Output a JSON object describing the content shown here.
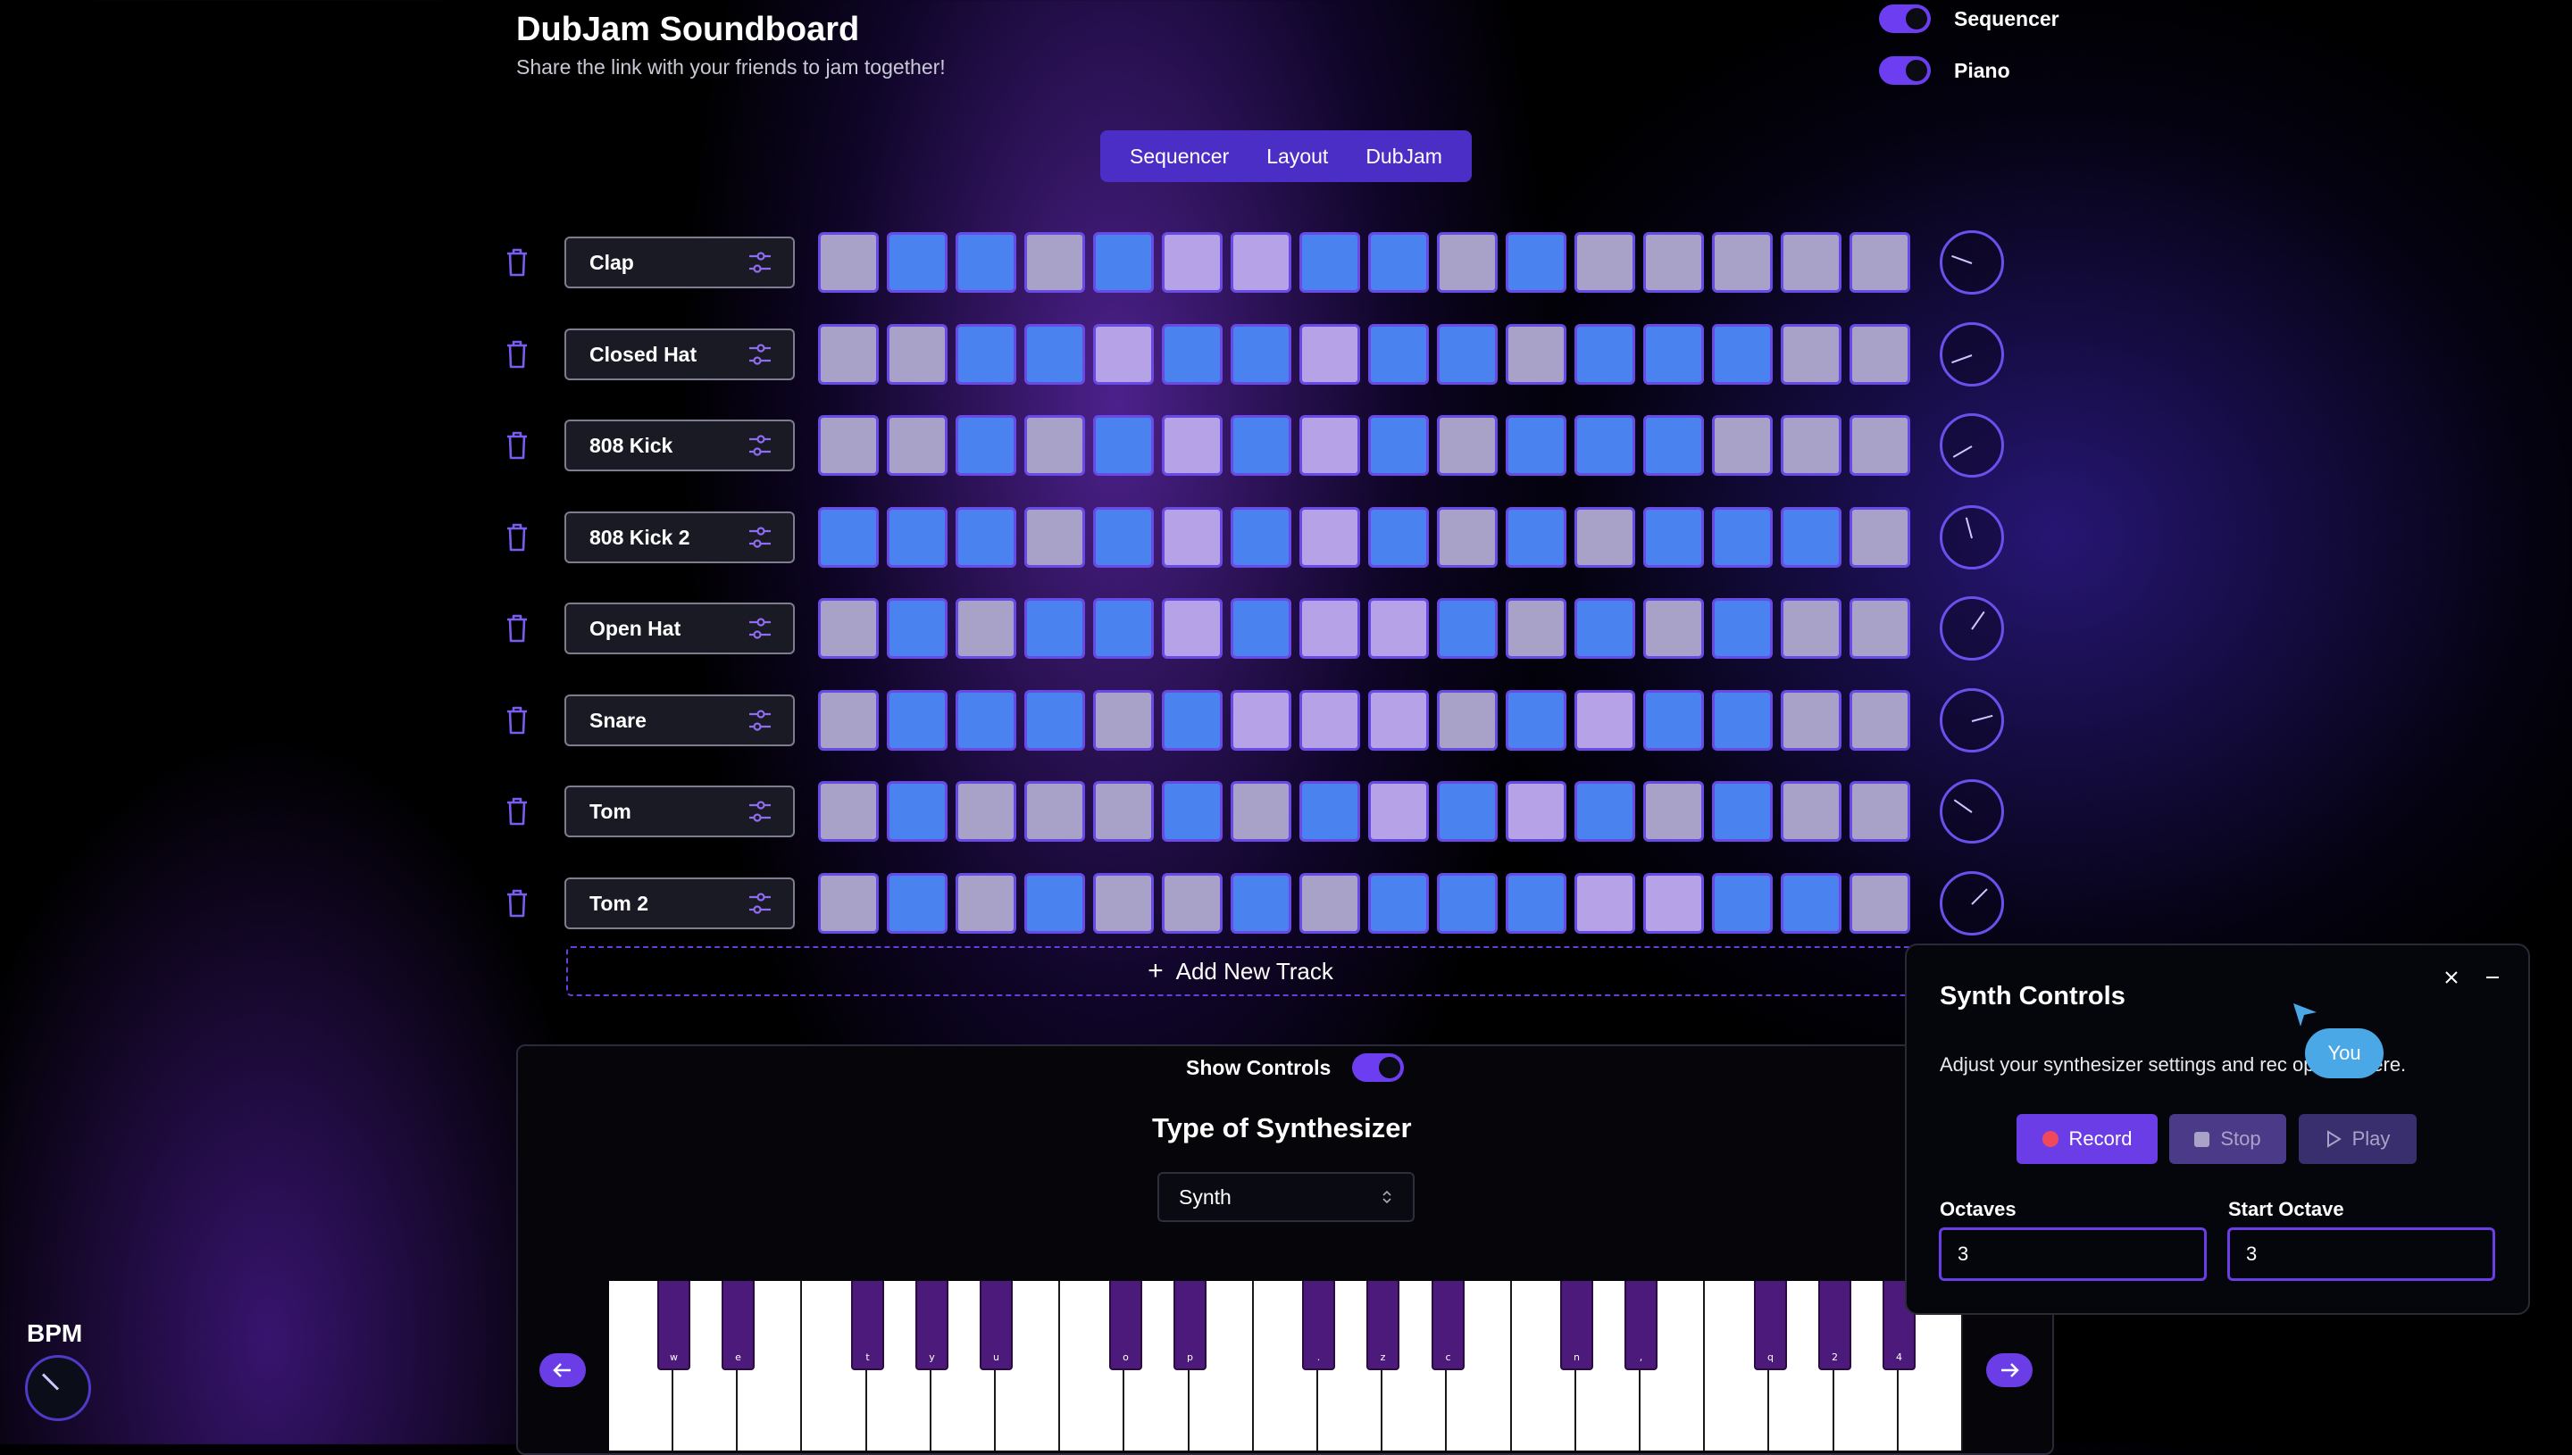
{
  "header": {
    "title": "DubJam Soundboard",
    "subtitle": "Share the link with your friends to jam together!"
  },
  "toggles": [
    {
      "label": "Sequencer",
      "on": true
    },
    {
      "label": "Piano",
      "on": true
    }
  ],
  "tabs": [
    "Sequencer",
    "Layout",
    "DubJam"
  ],
  "tracks": [
    {
      "name": "Clap",
      "steps": [
        0,
        1,
        1,
        0,
        1,
        2,
        2,
        1,
        1,
        0,
        1,
        0,
        0,
        0,
        0,
        0
      ],
      "knob_angle": 200
    },
    {
      "name": "Closed Hat",
      "steps": [
        0,
        0,
        1,
        1,
        2,
        1,
        1,
        2,
        1,
        1,
        0,
        1,
        1,
        1,
        0,
        0
      ],
      "knob_angle": 160
    },
    {
      "name": "808 Kick",
      "steps": [
        0,
        0,
        1,
        0,
        1,
        2,
        1,
        2,
        1,
        0,
        1,
        1,
        1,
        0,
        0,
        0
      ],
      "knob_angle": 150
    },
    {
      "name": "808 Kick 2",
      "steps": [
        1,
        1,
        1,
        0,
        1,
        2,
        1,
        2,
        1,
        0,
        1,
        0,
        1,
        1,
        1,
        0
      ],
      "knob_angle": 255
    },
    {
      "name": "Open Hat",
      "steps": [
        0,
        1,
        0,
        1,
        1,
        2,
        1,
        2,
        2,
        1,
        0,
        1,
        0,
        1,
        0,
        0
      ],
      "knob_angle": 305
    },
    {
      "name": "Snare",
      "steps": [
        0,
        1,
        1,
        1,
        0,
        1,
        2,
        2,
        2,
        0,
        1,
        2,
        1,
        1,
        0,
        0
      ],
      "knob_angle": 345
    },
    {
      "name": "Tom",
      "steps": [
        0,
        1,
        0,
        0,
        0,
        1,
        0,
        1,
        2,
        1,
        2,
        1,
        0,
        1,
        0,
        0
      ],
      "knob_angle": 215
    },
    {
      "name": "Tom 2",
      "steps": [
        0,
        1,
        0,
        1,
        0,
        0,
        1,
        0,
        1,
        1,
        1,
        2,
        2,
        1,
        1,
        0
      ],
      "knob_angle": 315
    }
  ],
  "step_colors": [
    "#a9a2c8",
    "#4a83ef",
    "#b6a2e6"
  ],
  "add_track": {
    "icon": "+",
    "label": "Add New Track"
  },
  "synth": {
    "show_controls_label": "Show Controls",
    "show_controls_on": true,
    "type_title": "Type of Synthesizer",
    "selected_type": "Synth",
    "black_keys": [
      "w",
      "e",
      "t",
      "y",
      "u",
      "o",
      "p",
      ".",
      "z",
      "c",
      "n",
      ",",
      "q",
      "2",
      "4"
    ]
  },
  "bpm": {
    "label": "BPM",
    "knob_angle": 225
  },
  "synth_controls": {
    "title": "Synth Controls",
    "description": "Adjust your synthesizer settings and rec                 options here.",
    "buttons": {
      "record": "Record",
      "stop": "Stop",
      "play": "Play"
    },
    "octaves_label": "Octaves",
    "octaves_value": "3",
    "start_octave_label": "Start Octave",
    "start_octave_value": "3"
  },
  "cursor": {
    "label": "You"
  }
}
